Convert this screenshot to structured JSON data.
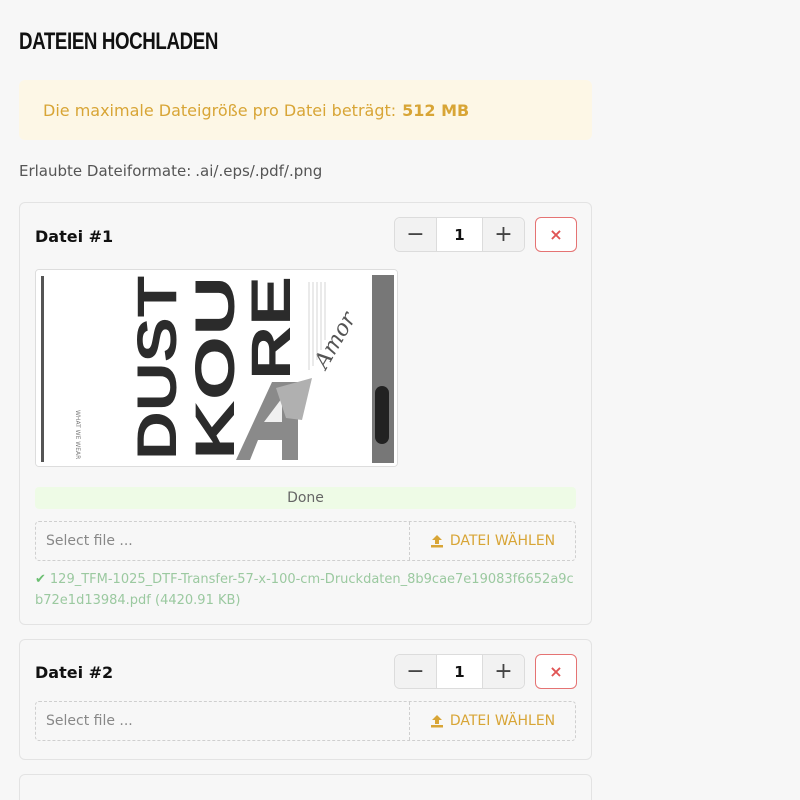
{
  "page": {
    "title": "DATEIEN HOCHLADEN"
  },
  "notice": {
    "text": "Die maximale Dateigröße pro Datei beträgt:",
    "size": "512 MB"
  },
  "formats": {
    "label": "Erlaubte Dateiformate:",
    "values": ".ai/.eps/.pdf/.png"
  },
  "files": [
    {
      "title": "Datei #1",
      "quantity": "1",
      "minus": "−",
      "plus": "+",
      "remove": "×",
      "status": "Done",
      "placeholder": "Select file ...",
      "choose_label": "DATEI WÄHLEN",
      "uploaded_name": "129_TFM-1025_DTF-Transfer-57-x-100-cm-Druckdaten_8b9cae7e19083f6652a9cb72e1d13984.pdf (4420.91 KB)",
      "preview": {
        "letters": [
          "DUST",
          "KOU",
          "RE",
          "A"
        ],
        "side_text": "WHAT WE WEAR",
        "script": "Amor"
      }
    },
    {
      "title": "Datei #2",
      "quantity": "1",
      "minus": "−",
      "plus": "+",
      "remove": "×",
      "placeholder": "Select file ...",
      "choose_label": "DATEI WÄHLEN"
    }
  ],
  "colors": {
    "accent": "#d8a536",
    "danger": "#e05555",
    "success": "#6cbf72"
  },
  "icons": {
    "upload": "upload-icon",
    "check": "check-icon",
    "close": "close-icon"
  }
}
